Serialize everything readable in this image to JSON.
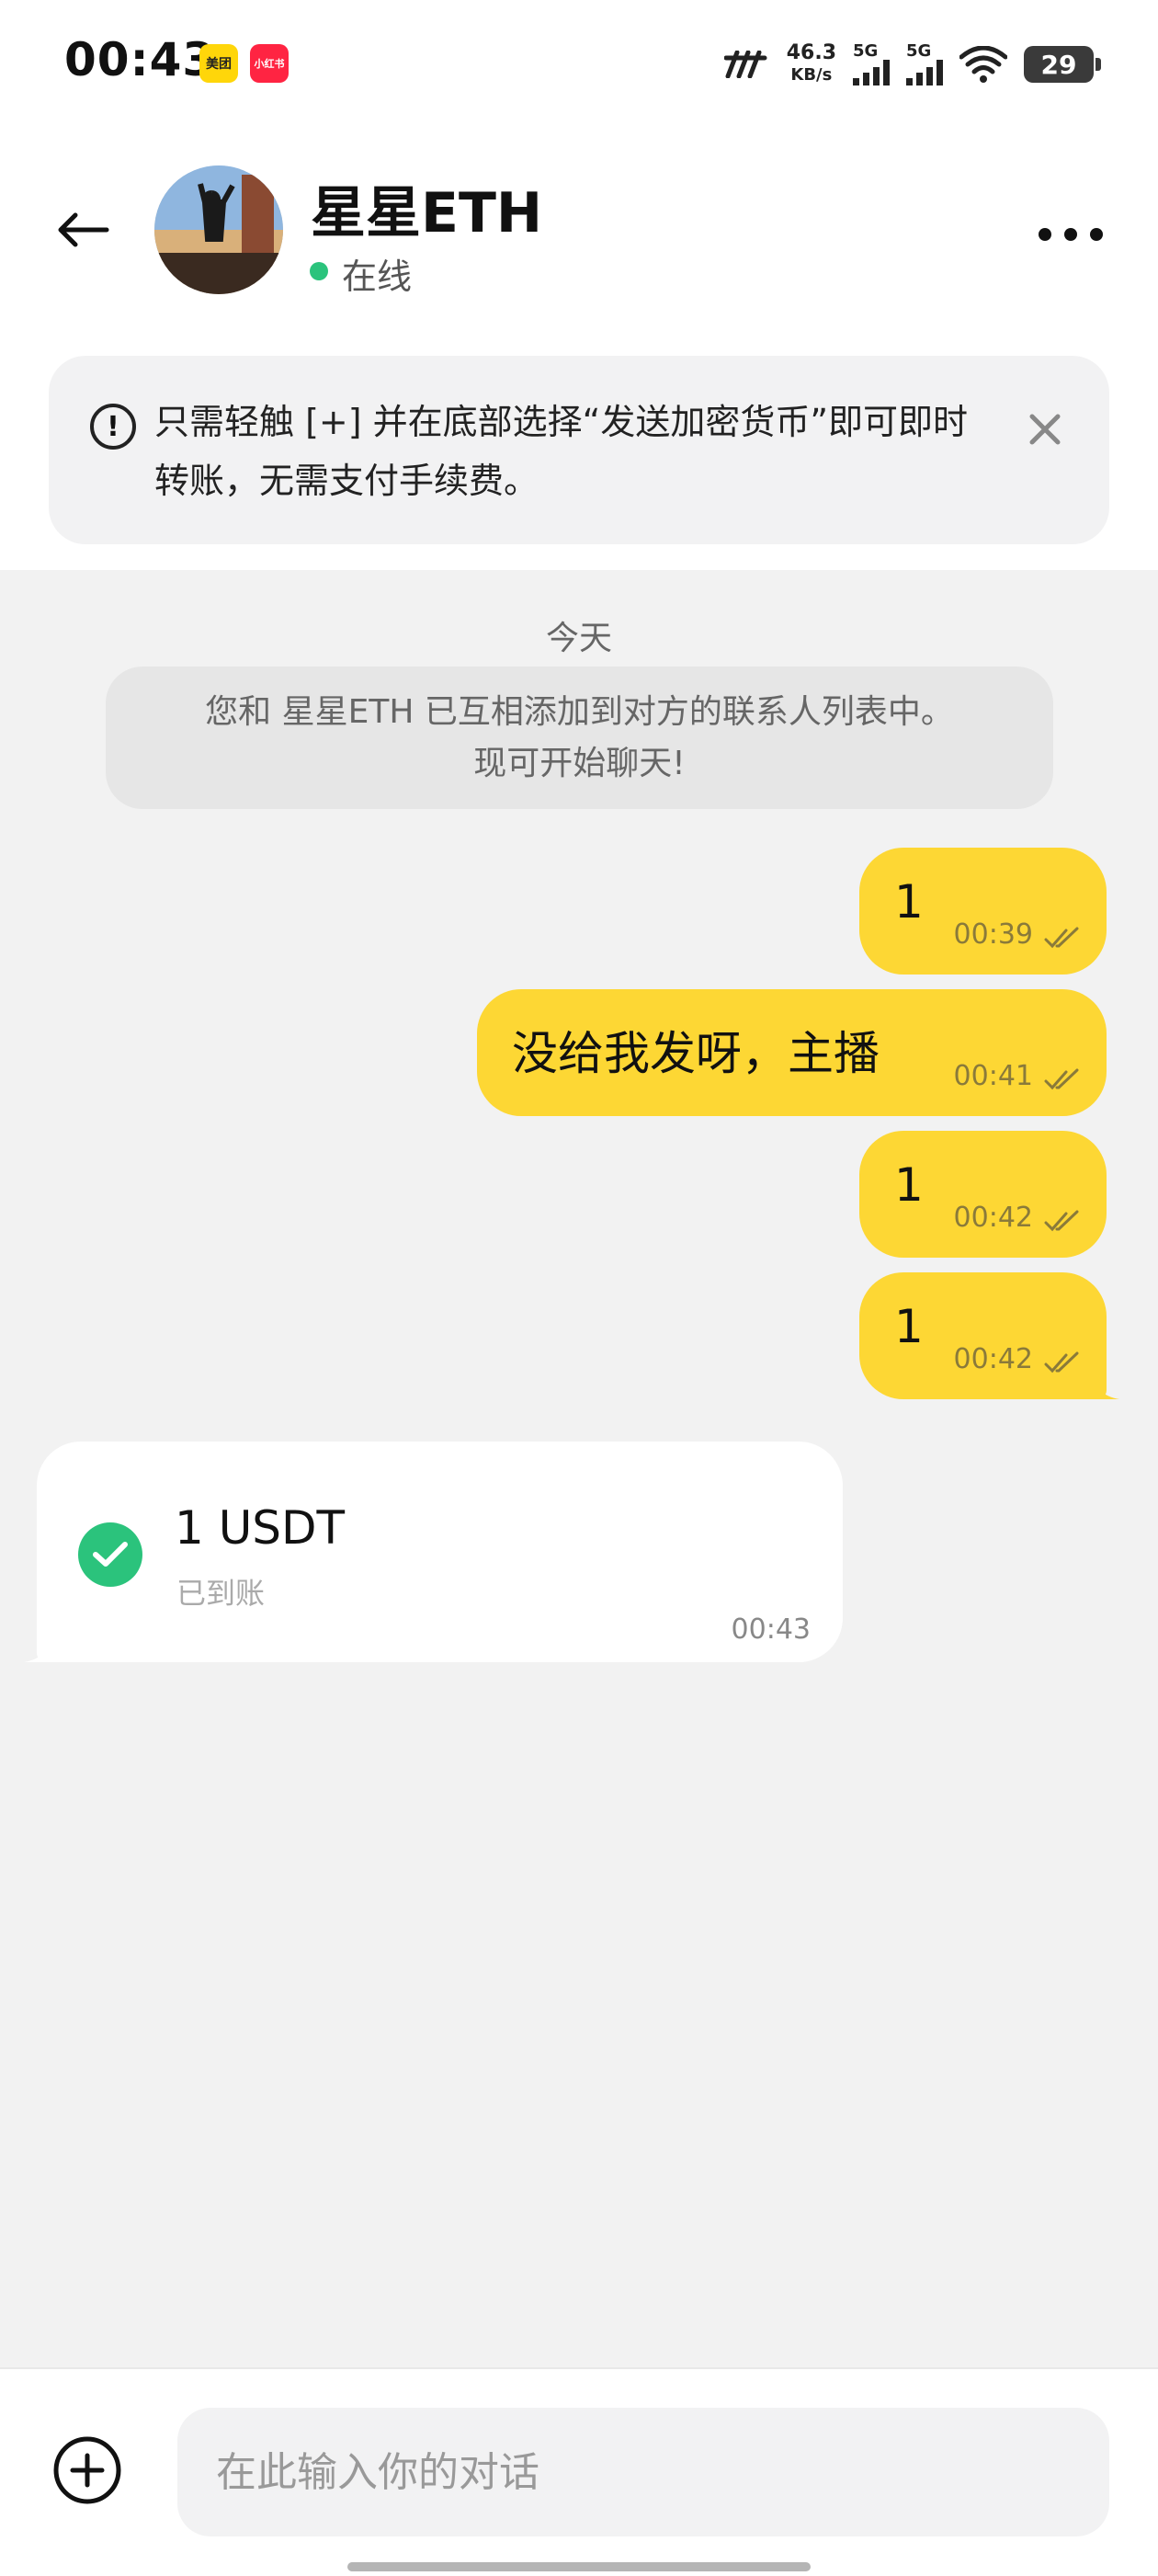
{
  "status_bar": {
    "time": "00:43",
    "app_badges": [
      "美团",
      "小红书"
    ],
    "net_speed_value": "46.3",
    "net_speed_unit": "KB/s",
    "signal_1": "5G",
    "signal_2": "5G",
    "battery": "29"
  },
  "header": {
    "contact_name": "星星ETH",
    "status": "在线"
  },
  "banner": {
    "text": "只需轻触 [+] 并在底部选择“发送加密货币”即可即时转账，无需支付手续费。"
  },
  "chat": {
    "date_label": "今天",
    "system_message_line1": "您和 星星ETH 已互相添加到对方的联系人列表中。",
    "system_message_line2": "现可开始聊天!",
    "messages": [
      {
        "text": "1",
        "time": "00:39"
      },
      {
        "text": "没给我发呀，主播",
        "time": "00:41"
      },
      {
        "text": "1",
        "time": "00:42"
      },
      {
        "text": "1",
        "time": "00:42"
      }
    ],
    "transfer": {
      "amount": "1 USDT",
      "status": "已到账",
      "time": "00:43"
    }
  },
  "composer": {
    "placeholder": "在此输入你的对话"
  },
  "colors": {
    "outgoing_bubble": "#fdd734",
    "chat_background": "#f2f2f2",
    "online_green": "#2bc37c"
  }
}
